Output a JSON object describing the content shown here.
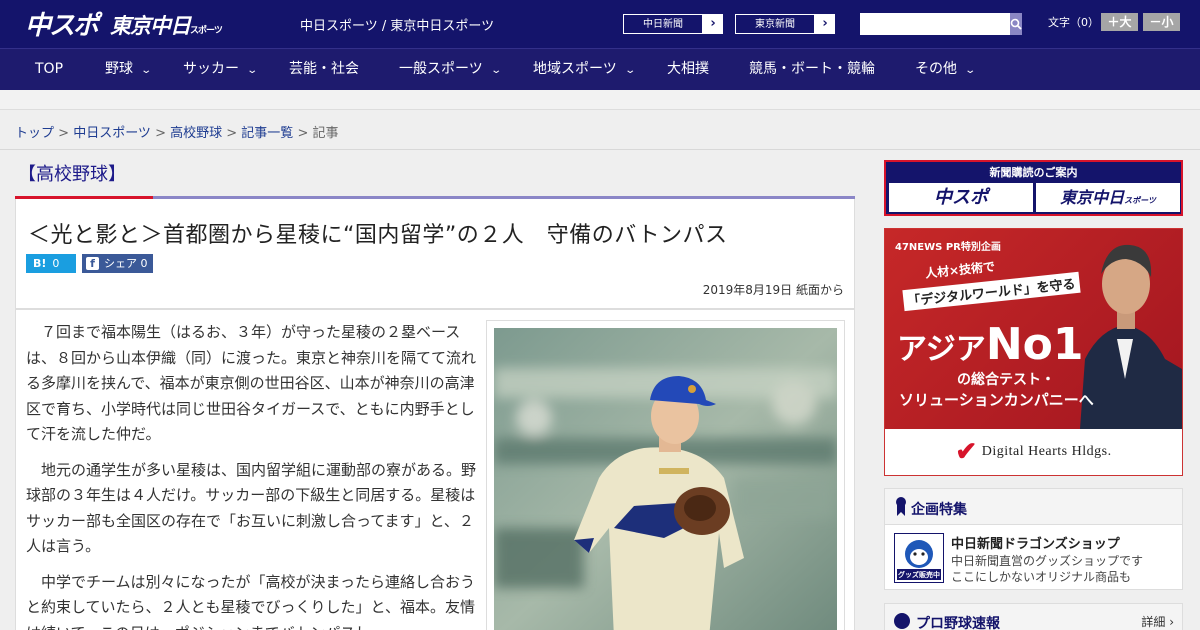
{
  "header": {
    "logo_chunichi": "中スポ",
    "logo_tokyo": "東京中日",
    "logo_tokyo_sub": "スポーツ",
    "site_names": "中日スポーツ / 東京中日スポーツ",
    "paper_links": [
      {
        "label": "中日新聞",
        "arrow": "›"
      },
      {
        "label": "東京新聞",
        "arrow": "›"
      }
    ],
    "search_placeholder": "",
    "font_size_label": "文字（0）",
    "font_bigger": "＋大",
    "font_smaller": "－小"
  },
  "nav": [
    {
      "label": "TOP",
      "has_menu": false
    },
    {
      "label": "野球",
      "has_menu": true
    },
    {
      "label": "サッカー",
      "has_menu": true
    },
    {
      "label": "芸能・社会",
      "has_menu": false
    },
    {
      "label": "一般スポーツ",
      "has_menu": true
    },
    {
      "label": "地域スポーツ",
      "has_menu": true
    },
    {
      "label": "大相撲",
      "has_menu": false
    },
    {
      "label": "競馬・ボート・競輪",
      "has_menu": false
    },
    {
      "label": "その他",
      "has_menu": true
    }
  ],
  "breadcrumb": {
    "items": [
      "トップ",
      "中日スポーツ",
      "高校野球",
      "記事一覧"
    ],
    "current": "記事",
    "separator": " > "
  },
  "article": {
    "category": "【高校野球】",
    "headline": "＜光と影と＞首都圏から星稜に“国内留学”の２人　守備のバトンパス",
    "hatena_label": "B!",
    "hatena_count": "0",
    "fb_label": "シェア",
    "fb_count": "0",
    "date": "2019年8月19日 紙面から",
    "paragraphs": [
      "７回まで福本陽生（はるお、３年）が守った星稜の２塁ベースは、８回から山本伊織（同）に渡った。東京と神奈川を隔てて流れる多摩川を挟んで、福本が東京側の世田谷区、山本が神奈川の高津区で育ち、小学時代は同じ世田谷タイガースで、ともに内野手として汗を流した仲だ。",
      "地元の通学生が多い星稜は、国内留学組に運動部の寮がある。野球部の３年生は４人だけ。サッカー部の下級生と同居する。星稜はサッカー部も全国区の存在で「お互いに刺激し合ってます」と、２人は言う。",
      "中学でチームは別々になったが「高校が決まったら連絡し合おうと約束していたら、２人とも星稜でびっくりした」と、福本。友情は続いて、この日は、ポジションまでバトンパスし"
    ]
  },
  "sidebar": {
    "subscribe_title": "新聞購読のご案内",
    "subscribe_logo_1": "中スポ",
    "subscribe_logo_2": "東京中日",
    "subscribe_logo_2_sub": "スポーツ",
    "ad": {
      "tag": "47NEWS PR特別企画",
      "line1": "人材×技術で",
      "line2": "「デジタルワールド」を守る",
      "big_prefix": "アジア",
      "big_no1": "No1",
      "line3": "の総合テスト・",
      "line4": "ソリューションカンパニーへ",
      "company": "Digital Hearts Hldgs.",
      "check": "✔"
    },
    "feature": {
      "title": "企画特集",
      "item_name": "中日新聞ドラゴンズショップ",
      "item_desc_1": "中日新聞直営のグッズショップです",
      "item_desc_2": "ここにしかないオリジナル商品も",
      "thumb_label": "グッズ販売中"
    },
    "baseball": {
      "title": "プロ野球速報",
      "more": "詳細 ›"
    }
  },
  "colors": {
    "brand_navy": "#14146b",
    "nav_bg": "#1e1b6e",
    "accent_red": "#d7142b",
    "link_blue": "#1e3c91",
    "hatena_blue": "#1a9ee0",
    "facebook_blue": "#3b5998"
  }
}
